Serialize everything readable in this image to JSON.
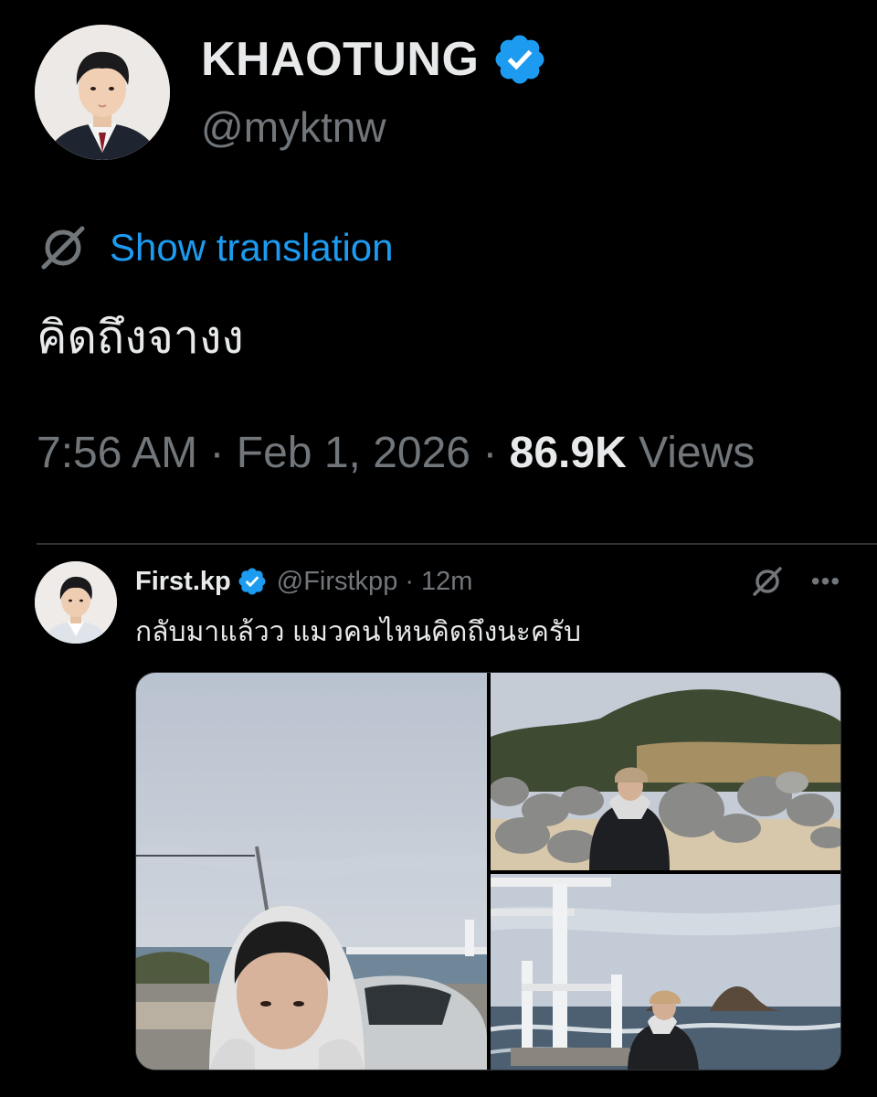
{
  "tweet": {
    "display_name": "KHAOTUNG",
    "handle": "@myktnw",
    "verified_icon": "verified-badge-icon",
    "show_translation_label": "Show translation",
    "text": "คิดถึงจางง",
    "time": "7:56 AM",
    "date": "Feb 1, 2026",
    "separator": "·",
    "views_count": "86.9K",
    "views_label": "Views"
  },
  "quoted": {
    "display_name": "First.kp",
    "handle": "@Firstkpp",
    "separator": "·",
    "time_ago": "12m",
    "text": "กลับมาแล้วว แมวคนไหนคิดถึงนะครับ",
    "more_icon": "more-options-icon",
    "translate_icon": "globe-icon",
    "media_count": 3
  },
  "colors": {
    "background": "#000000",
    "primary_text": "#e7e9ea",
    "secondary_text": "#71767b",
    "link": "#1d9bf0",
    "verified": "#1d9bf0",
    "divider": "#2f3336"
  }
}
